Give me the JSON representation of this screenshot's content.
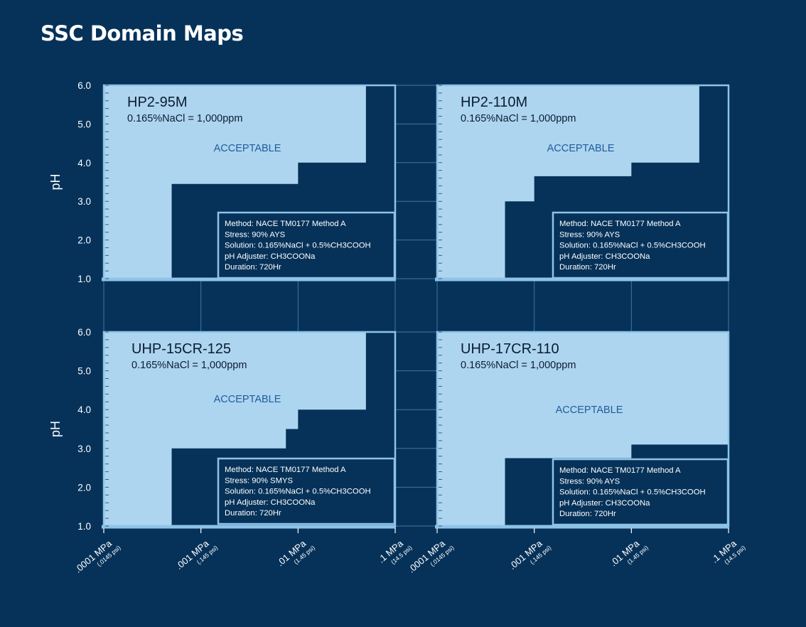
{
  "page": {
    "title": "SSC Domain Maps"
  },
  "colors": {
    "background": "#063259",
    "acceptable_fill": "#aed5ef",
    "border": "#8ec3e8",
    "grid": "#3e76a6",
    "acceptable_text": "#1f5c9c"
  },
  "axes": {
    "y_label": "pH",
    "y_ticks": [
      "1.0",
      "2.0",
      "3.0",
      "4.0",
      "5.0",
      "6.0"
    ],
    "y_range": [
      1.0,
      6.0
    ],
    "x_scale": "log",
    "x_range": [
      0.0001,
      0.1
    ],
    "x_ticks": [
      {
        "value": 0.0001,
        "label": ".0001 MPa",
        "sublabel": "(.0145 psi)"
      },
      {
        "value": 0.001,
        "label": ".001 MPa",
        "sublabel": "(.145 psi)"
      },
      {
        "value": 0.01,
        "label": ".01 MPa",
        "sublabel": "(1.45 psi)"
      },
      {
        "value": 0.1,
        "label": ".1 MPa",
        "sublabel": "(14.5 psi)"
      }
    ]
  },
  "chart_data": [
    {
      "type": "area",
      "title": "HP2-95M",
      "subtitle": "0.165%NaCl = 1,000ppm",
      "region_label": "ACCEPTABLE",
      "boundary": {
        "x_mpa": [
          0.0001,
          0.0005,
          0.01,
          0.05,
          0.1
        ],
        "ph": [
          1.0,
          3.45,
          4.0,
          6.0,
          6.0
        ]
      },
      "test_conditions": [
        "Method: NACE TM0177 Method A",
        "Stress: 90% AYS",
        "Solution: 0.165%NaCl + 0.5%CH3COOH",
        "pH Adjuster: CH3COONa",
        "Duration: 720Hr"
      ]
    },
    {
      "type": "area",
      "title": "HP2-110M",
      "subtitle": "0.165%NaCl = 1,000ppm",
      "region_label": "ACCEPTABLE",
      "boundary": {
        "x_mpa": [
          0.0001,
          0.0005,
          0.001,
          0.01,
          0.05,
          0.1
        ],
        "ph": [
          1.0,
          3.0,
          3.65,
          4.0,
          6.0,
          6.0
        ]
      },
      "test_conditions": [
        "Method: NACE TM0177 Method A",
        "Stress: 90% AYS",
        "Solution: 0.165%NaCl + 0.5%CH3COOH",
        "pH Adjuster: CH3COONa",
        "Duration: 720Hr"
      ]
    },
    {
      "type": "area",
      "title": "UHP-15CR-125",
      "subtitle": "0.165%NaCl = 1,000ppm",
      "region_label": "ACCEPTABLE",
      "boundary": {
        "x_mpa": [
          0.0001,
          0.0005,
          0.0075,
          0.01,
          0.05,
          0.1
        ],
        "ph": [
          1.0,
          3.0,
          3.5,
          4.0,
          6.0,
          6.0
        ]
      },
      "test_conditions": [
        "Method: NACE TM0177 Method A",
        "Stress: 90% SMYS",
        "Solution: 0.165%NaCl + 0.5%CH3COOH",
        "pH Adjuster: CH3COONa",
        "Duration: 720Hr"
      ]
    },
    {
      "type": "area",
      "title": "UHP-17CR-110",
      "subtitle": "0.165%NaCl = 1,000ppm",
      "region_label": "ACCEPTABLE",
      "boundary": {
        "x_mpa": [
          0.0001,
          0.0005,
          0.01,
          0.1
        ],
        "ph": [
          1.0,
          2.75,
          3.1,
          3.1
        ]
      },
      "test_conditions": [
        "Method: NACE TM0177 Method A",
        "Stress: 90% AYS",
        "Solution: 0.165%NaCl + 0.5%CH3COOH",
        "pH Adjuster: CH3COONa",
        "Duration: 720Hr"
      ]
    }
  ]
}
